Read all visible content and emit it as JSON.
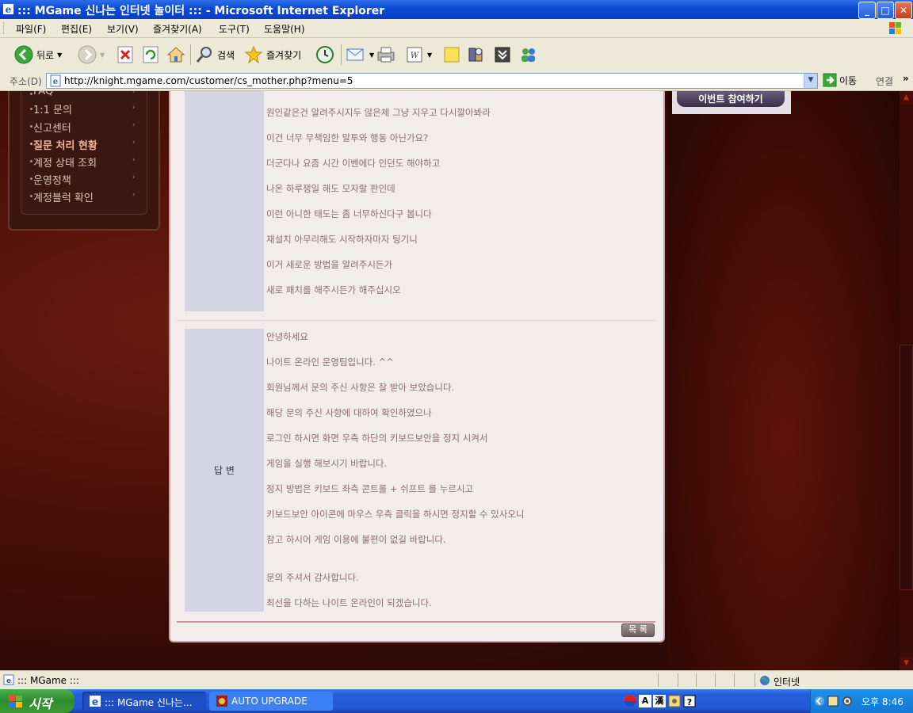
{
  "window": {
    "title": "::: MGame 신나는 인터넷 놀이터 ::: - Microsoft Internet Explorer",
    "min": "_",
    "max": "□",
    "close": "✕"
  },
  "menu": [
    "파일(F)",
    "편집(E)",
    "보기(V)",
    "즐겨찾기(A)",
    "도구(T)",
    "도움말(H)"
  ],
  "toolbar": {
    "back": "뒤로",
    "search": "검색",
    "favorites": "즐겨찾기"
  },
  "address": {
    "label": "주소(D)",
    "url": "http://knight.mgame.com/customer/cs_mother.php?menu=5",
    "go": "이동",
    "links": "연결",
    "more": "»"
  },
  "sidebar": {
    "items": [
      {
        "label": "FAQ"
      },
      {
        "label": "1:1 문의"
      },
      {
        "label": "신고센터"
      },
      {
        "label": "질문 처리 현황",
        "active": true
      },
      {
        "label": "계정 상태 조회"
      },
      {
        "label": "운영정책"
      },
      {
        "label": "계정블럭 확인"
      }
    ],
    "arrow": "›"
  },
  "banner": {
    "text": "이번트 참여하기"
  },
  "question": {
    "lines": [
      "원인같은건 알려주시지두 않은체 그냥 지우고 다시깔아봐라",
      "이건 너무 무책임한 말투와 행동 아닌가요?",
      "더군다나 요즘 시간 이벤에다 인던도 해야하고",
      "나온 하루쟁일 해도 모자랄 판인데",
      "이런 아니한 태도는 좀 너무하신다구 봅니다",
      "재설치 아무리해도 시작하자마자 팅기니",
      "이거 새로운 방법을 알려주시든가",
      "새로 패치를 해주시든가 해주십시오"
    ]
  },
  "answer": {
    "label": "답 변",
    "lines": [
      "안녕하세요",
      "나이트 온라인 운영팀입니다. ^^",
      "회원님께서 문의 주신 사항은 잘 받아 보았습니다.",
      "해당 문의 주신 사항에 대하여 확인하였으나",
      "로그인 하시면 화면 우측 하단의 키보드보안을 정지 시켜서",
      "게임을 실행 해보시기 바랍니다.",
      "정지 방법은 키보드 좌측 콘트롤 + 쉬프트 를 누르시고",
      "키보드보안 아이콘에 마우스 우측 클릭을 하시면 정지할 수 있사오니",
      "참고 하시어 게임 이용에 불편이 없길 바랍니다.",
      "문의 주셔서 감사합니다.",
      "최선을  다하는 나이트 온라인이 되겠습니다."
    ]
  },
  "list_button": "목 록",
  "status": {
    "text": "::: MGame :::",
    "zone": "인터넷"
  },
  "taskbar": {
    "start": "시작",
    "tasks": [
      "::: MGame 신나는...",
      "AUTO UPGRADE"
    ],
    "ime_a": "A",
    "ime_han": "漢",
    "clock": "오후 8:46"
  }
}
